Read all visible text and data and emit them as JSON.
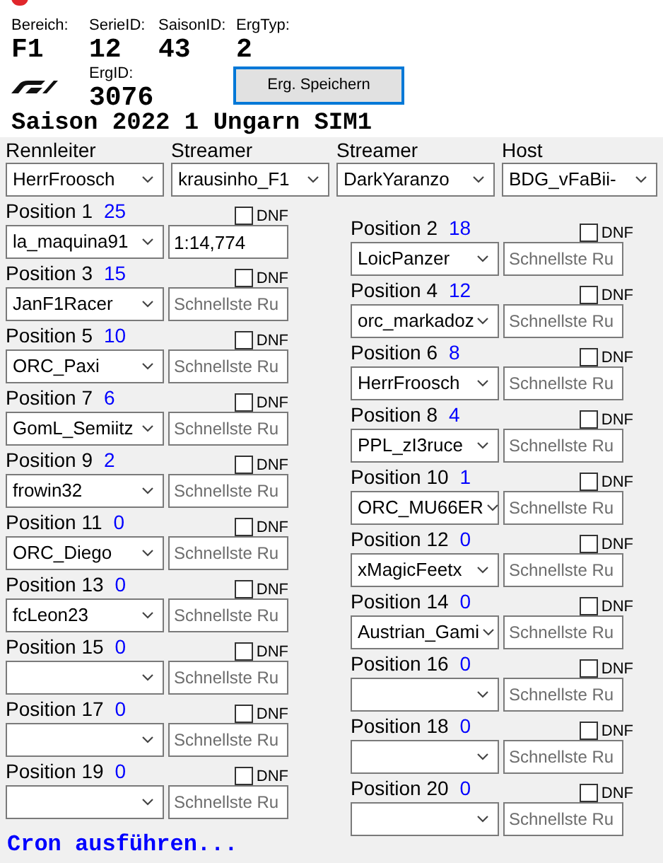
{
  "header": {
    "fields": [
      {
        "label": "Bereich:",
        "value": "F1"
      },
      {
        "label": "SerieID:",
        "value": "12"
      },
      {
        "label": "SaisonID:",
        "value": "43"
      },
      {
        "label": "ErgTyp:",
        "value": "2"
      }
    ],
    "erg_id": {
      "label": "ErgID:",
      "value": "3076"
    },
    "save_button": "Erg. Speichern",
    "title": "Saison 2022 1 Ungarn SIM1"
  },
  "staff": [
    {
      "label": "Rennleiter",
      "value": "HerrFroosch"
    },
    {
      "label": "Streamer",
      "value": "krausinho_F1"
    },
    {
      "label": "Streamer",
      "value": "DarkYaranzo"
    },
    {
      "label": "Host",
      "value": "BDG_vFaBii-"
    }
  ],
  "positions": [
    {
      "label": "Position 1",
      "points": "25",
      "driver": "la_maquina91",
      "lap_time": "1:14,774",
      "dnf": false,
      "dnf_label": "DNF"
    },
    {
      "label": "Position 2",
      "points": "18",
      "driver": "LoicPanzer",
      "placeholder": "Schnellste Ru",
      "dnf": false,
      "dnf_label": "DNF"
    },
    {
      "label": "Position 3",
      "points": "15",
      "driver": "JanF1Racer",
      "placeholder": "Schnellste Ru",
      "dnf": false,
      "dnf_label": "DNF"
    },
    {
      "label": "Position 4",
      "points": "12",
      "driver": "orc_markadoz",
      "placeholder": "Schnellste Ru",
      "dnf": false,
      "dnf_label": "DNF"
    },
    {
      "label": "Position 5",
      "points": "10",
      "driver": "ORC_Paxi",
      "placeholder": "Schnellste Ru",
      "dnf": false,
      "dnf_label": "DNF"
    },
    {
      "label": "Position 6",
      "points": "8",
      "driver": "HerrFroosch",
      "placeholder": "Schnellste Ru",
      "dnf": false,
      "dnf_label": "DNF"
    },
    {
      "label": "Position 7",
      "points": "6",
      "driver": "GomL_Semiitz",
      "placeholder": "Schnellste Ru",
      "dnf": false,
      "dnf_label": "DNF"
    },
    {
      "label": "Position 8",
      "points": "4",
      "driver": "PPL_zI3ruce",
      "placeholder": "Schnellste Ru",
      "dnf": false,
      "dnf_label": "DNF"
    },
    {
      "label": "Position 9",
      "points": "2",
      "driver": "frowin32",
      "placeholder": "Schnellste Ru",
      "dnf": false,
      "dnf_label": "DNF"
    },
    {
      "label": "Position 10",
      "points": "1",
      "driver": "ORC_MU66ER",
      "placeholder": "Schnellste Ru",
      "dnf": false,
      "dnf_label": "DNF"
    },
    {
      "label": "Position 11",
      "points": "0",
      "driver": "ORC_Diego",
      "placeholder": "Schnellste Ru",
      "dnf": false,
      "dnf_label": "DNF"
    },
    {
      "label": "Position 12",
      "points": "0",
      "driver": "xMagicFeetx",
      "placeholder": "Schnellste Ru",
      "dnf": false,
      "dnf_label": "DNF"
    },
    {
      "label": "Position 13",
      "points": "0",
      "driver": "fcLeon23",
      "placeholder": "Schnellste Ru",
      "dnf": false,
      "dnf_label": "DNF"
    },
    {
      "label": "Position 14",
      "points": "0",
      "driver": "Austrian_Gami",
      "placeholder": "Schnellste Ru",
      "dnf": false,
      "dnf_label": "DNF"
    },
    {
      "label": "Position 15",
      "points": "0",
      "placeholder": "Schnellste Ru",
      "dnf": false,
      "dnf_label": "DNF"
    },
    {
      "label": "Position 16",
      "points": "0",
      "placeholder": "Schnellste Ru",
      "dnf": false,
      "dnf_label": "DNF"
    },
    {
      "label": "Position 17",
      "points": "0",
      "placeholder": "Schnellste Ru",
      "dnf": false,
      "dnf_label": "DNF"
    },
    {
      "label": "Position 18",
      "points": "0",
      "placeholder": "Schnellste Ru",
      "dnf": false,
      "dnf_label": "DNF"
    },
    {
      "label": "Position 19",
      "points": "0",
      "placeholder": "Schnellste Ru",
      "dnf": false,
      "dnf_label": "DNF"
    },
    {
      "label": "Position 20",
      "points": "0",
      "placeholder": "Schnellste Ru",
      "dnf": false,
      "dnf_label": "DNF"
    }
  ],
  "cron_link": "Cron ausführen..."
}
